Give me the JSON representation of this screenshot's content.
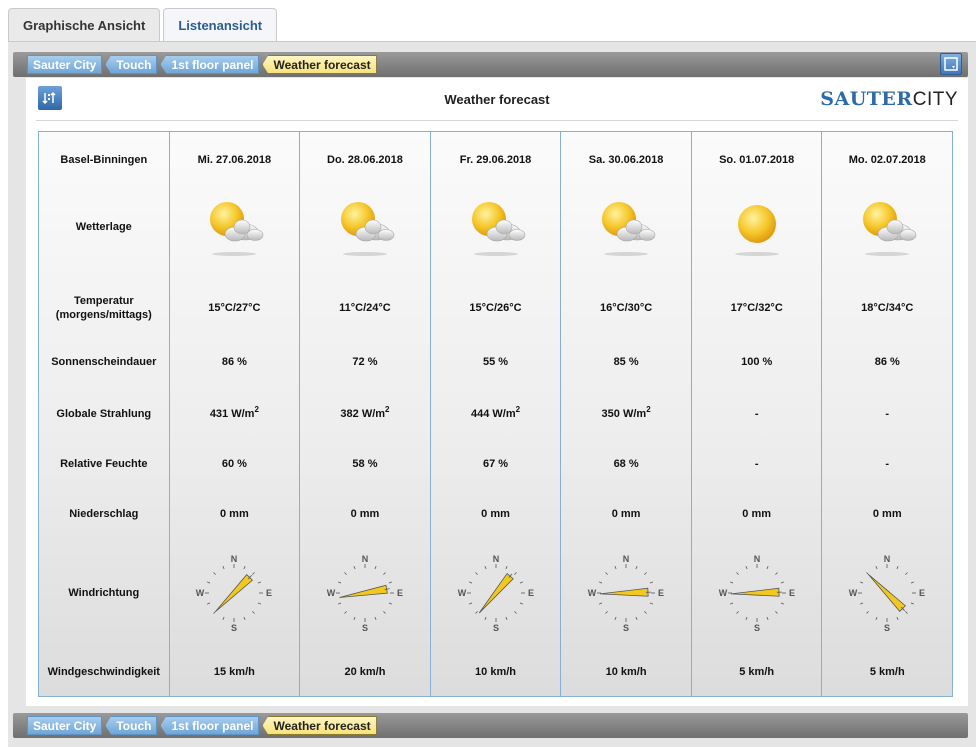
{
  "tabs": [
    {
      "label": "Graphische Ansicht",
      "active": true
    },
    {
      "label": "Listenansicht",
      "active": false
    }
  ],
  "breadcrumb": [
    "Sauter City",
    "Touch",
    "1st floor panel",
    "Weather forecast"
  ],
  "header": {
    "title": "Weather forecast",
    "brand_bold": "SAUTER",
    "brand_light": "CITY"
  },
  "table": {
    "row_labels": {
      "location": "Basel-Binningen",
      "weather": "Wetterlage",
      "temperature": "Temperatur (morgens/mittags)",
      "sunshine": "Sonnenscheindauer",
      "radiation": "Globale Strahlung",
      "humidity": "Relative Feuchte",
      "precipitation": "Niederschlag",
      "wind_direction": "Windrichtung",
      "wind_speed": "Windgeschwindigkeit"
    },
    "compass": {
      "n": "N",
      "e": "E",
      "s": "S",
      "w": "W"
    },
    "days": [
      {
        "date": "Mi. 27.06.2018",
        "icon": "sun-cloud-icon",
        "temp": "15°C/27°C",
        "sun": "86 %",
        "rad_value": "431",
        "rad_unit": "W/m",
        "rad_exp": "2",
        "humidity": "60 %",
        "precip": "0 mm",
        "wind_deg": 45,
        "wind_speed": "15 km/h"
      },
      {
        "date": "Do. 28.06.2018",
        "icon": "sun-cloud-icon",
        "temp": "11°C/24°C",
        "sun": "72 %",
        "rad_value": "382",
        "rad_unit": "W/m",
        "rad_exp": "2",
        "humidity": "58 %",
        "precip": "0 mm",
        "wind_deg": 80,
        "wind_speed": "20 km/h"
      },
      {
        "date": "Fr. 29.06.2018",
        "icon": "sun-cloud-icon",
        "temp": "15°C/26°C",
        "sun": "55 %",
        "rad_value": "444",
        "rad_unit": "W/m",
        "rad_exp": "2",
        "humidity": "67 %",
        "precip": "0 mm",
        "wind_deg": 40,
        "wind_speed": "10 km/h"
      },
      {
        "date": "Sa. 30.06.2018",
        "icon": "sun-cloud-icon",
        "temp": "16°C/30°C",
        "sun": "85 %",
        "rad_value": "350",
        "rad_unit": "W/m",
        "rad_exp": "2",
        "humidity": "68 %",
        "precip": "0 mm",
        "wind_deg": 88,
        "wind_speed": "10 km/h"
      },
      {
        "date": "So. 01.07.2018",
        "icon": "sun-icon",
        "temp": "17°C/32°C",
        "sun": "100 %",
        "rad_value": "-",
        "rad_unit": "",
        "rad_exp": "",
        "humidity": "-",
        "precip": "0 mm",
        "wind_deg": 88,
        "wind_speed": "5 km/h"
      },
      {
        "date": "Mo. 02.07.2018",
        "icon": "sun-cloud-icon",
        "temp": "18°C/34°C",
        "sun": "86 %",
        "rad_value": "-",
        "rad_unit": "",
        "rad_exp": "",
        "humidity": "-",
        "precip": "0 mm",
        "wind_deg": 135,
        "wind_speed": "5 km/h"
      }
    ]
  },
  "colors": {
    "accent_blue": "#2d6aa8",
    "breadcrumb_blue": "#6fa6d8",
    "breadcrumb_current": "#f7e27c",
    "table_border": "#84b0d6",
    "wind_arrow": "#f2c81e"
  }
}
